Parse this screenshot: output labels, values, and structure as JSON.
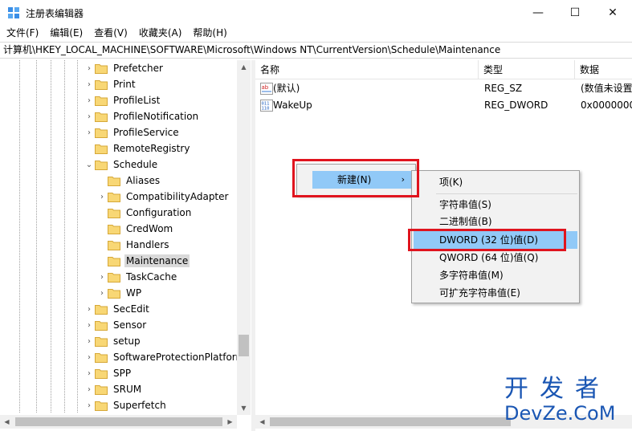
{
  "window": {
    "title": "注册表编辑器",
    "minimize_glyph": "—",
    "maximize_glyph": "☐",
    "close_glyph": "✕"
  },
  "menubar": {
    "items": [
      "文件(F)",
      "编辑(E)",
      "查看(V)",
      "收藏夹(A)",
      "帮助(H)"
    ]
  },
  "address": {
    "path": "计算机\\HKEY_LOCAL_MACHINE\\SOFTWARE\\Microsoft\\Windows NT\\CurrentVersion\\Schedule\\Maintenance"
  },
  "tree": {
    "items": [
      {
        "label": "Prefetcher",
        "level": 1,
        "expander": ">"
      },
      {
        "label": "Print",
        "level": 1,
        "expander": ">"
      },
      {
        "label": "ProfileList",
        "level": 1,
        "expander": ">"
      },
      {
        "label": "ProfileNotification",
        "level": 1,
        "expander": ">"
      },
      {
        "label": "ProfileService",
        "level": 1,
        "expander": ">"
      },
      {
        "label": "RemoteRegistry",
        "level": 1,
        "expander": ""
      },
      {
        "label": "Schedule",
        "level": 1,
        "expander": "v"
      },
      {
        "label": "Aliases",
        "level": 2,
        "expander": ""
      },
      {
        "label": "CompatibilityAdapter",
        "level": 2,
        "expander": ">"
      },
      {
        "label": "Configuration",
        "level": 2,
        "expander": ""
      },
      {
        "label": "CredWom",
        "level": 2,
        "expander": ""
      },
      {
        "label": "Handlers",
        "level": 2,
        "expander": ""
      },
      {
        "label": "Maintenance",
        "level": 2,
        "expander": "",
        "selected": true
      },
      {
        "label": "TaskCache",
        "level": 2,
        "expander": ">"
      },
      {
        "label": "WP",
        "level": 2,
        "expander": ">"
      },
      {
        "label": "SecEdit",
        "level": 1,
        "expander": ">"
      },
      {
        "label": "Sensor",
        "level": 1,
        "expander": ">"
      },
      {
        "label": "setup",
        "level": 1,
        "expander": ">"
      },
      {
        "label": "SoftwareProtectionPlatform",
        "level": 1,
        "expander": ">"
      },
      {
        "label": "SPP",
        "level": 1,
        "expander": ">"
      },
      {
        "label": "SRUM",
        "level": 1,
        "expander": ">"
      },
      {
        "label": "Superfetch",
        "level": 1,
        "expander": ">"
      }
    ]
  },
  "list": {
    "columns": [
      "名称",
      "类型",
      "数据"
    ],
    "rows": [
      {
        "name": "(默认)",
        "type": "REG_SZ",
        "data": "(数值未设置",
        "icon": "string-value-icon"
      },
      {
        "name": "WakeUp",
        "type": "REG_DWORD",
        "data": "0x0000000",
        "icon": "binary-value-icon"
      }
    ]
  },
  "context_menu": {
    "new_label": "新建(N)",
    "submenu_arrow": "›"
  },
  "submenu": {
    "key": "项(K)",
    "string": "字符串值(S)",
    "binary": "二进制值(B)",
    "dword": "DWORD (32 位)值(D)",
    "qword": "QWORD (64 位)值(Q)",
    "multi": "多字符串值(M)",
    "expand": "可扩充字符串值(E)"
  },
  "watermark": {
    "line1": "开发者",
    "line2": "DevZe.CoM"
  },
  "colors": {
    "highlight": "#91c9f7",
    "annotation_red": "#e0141e",
    "folder_yellow": "#f8d775",
    "watermark_blue": "#1a56b3"
  }
}
